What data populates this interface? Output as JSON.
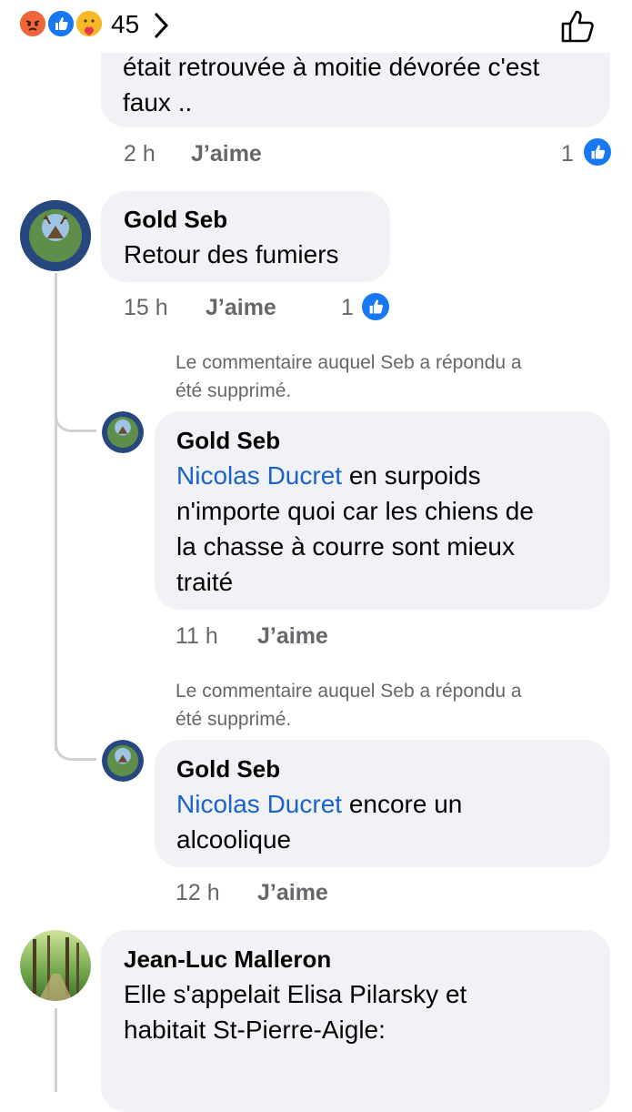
{
  "reactions_bar": {
    "count": "45",
    "icons": [
      "angry-reaction-icon",
      "like-reaction-icon",
      "care-reaction-icon"
    ]
  },
  "comments": [
    {
      "author": "",
      "text_partial": "était retrouvée à moitie dévorée c'est",
      "text_tail": "faux ..",
      "time": "2 h",
      "like_label": "J’aime",
      "like_count": "1"
    },
    {
      "author": "Gold Seb",
      "text": "Retour des fumiers",
      "time": "15 h",
      "like_label": "J’aime",
      "like_count": "1",
      "avatar": "deer-emblem-avatar"
    }
  ],
  "replies": [
    {
      "deleted_notice_1": "Le commentaire auquel Seb a répondu a",
      "deleted_notice_2": "été supprimé.",
      "author": "Gold Seb",
      "mention": "Nicolas Ducret",
      "line1_rest": " en surpoids",
      "line2": "n'importe quoi car les chiens de",
      "line3": "la chasse à courre sont mieux",
      "line4": "traité",
      "time": "11 h",
      "like_label": "J’aime"
    },
    {
      "deleted_notice_1": "Le commentaire auquel Seb a répondu a",
      "deleted_notice_2": "été supprimé.",
      "author": "Gold Seb",
      "mention": "Nicolas Ducret",
      "line1_rest": " encore un",
      "line2": "alcoolique",
      "time": "12 h",
      "like_label": "J’aime"
    }
  ],
  "last_comment": {
    "author": "Jean-Luc Malleron",
    "line1": "Elle s'appelait Elisa Pilarsky et",
    "line2": "habitait St-Pierre-Aigle:",
    "avatar": "forest-avatar"
  },
  "colors": {
    "bubble": "#f0f2f5",
    "mention": "#1b63c9",
    "meta": "#65676b",
    "like_blue": "#1877f2"
  }
}
